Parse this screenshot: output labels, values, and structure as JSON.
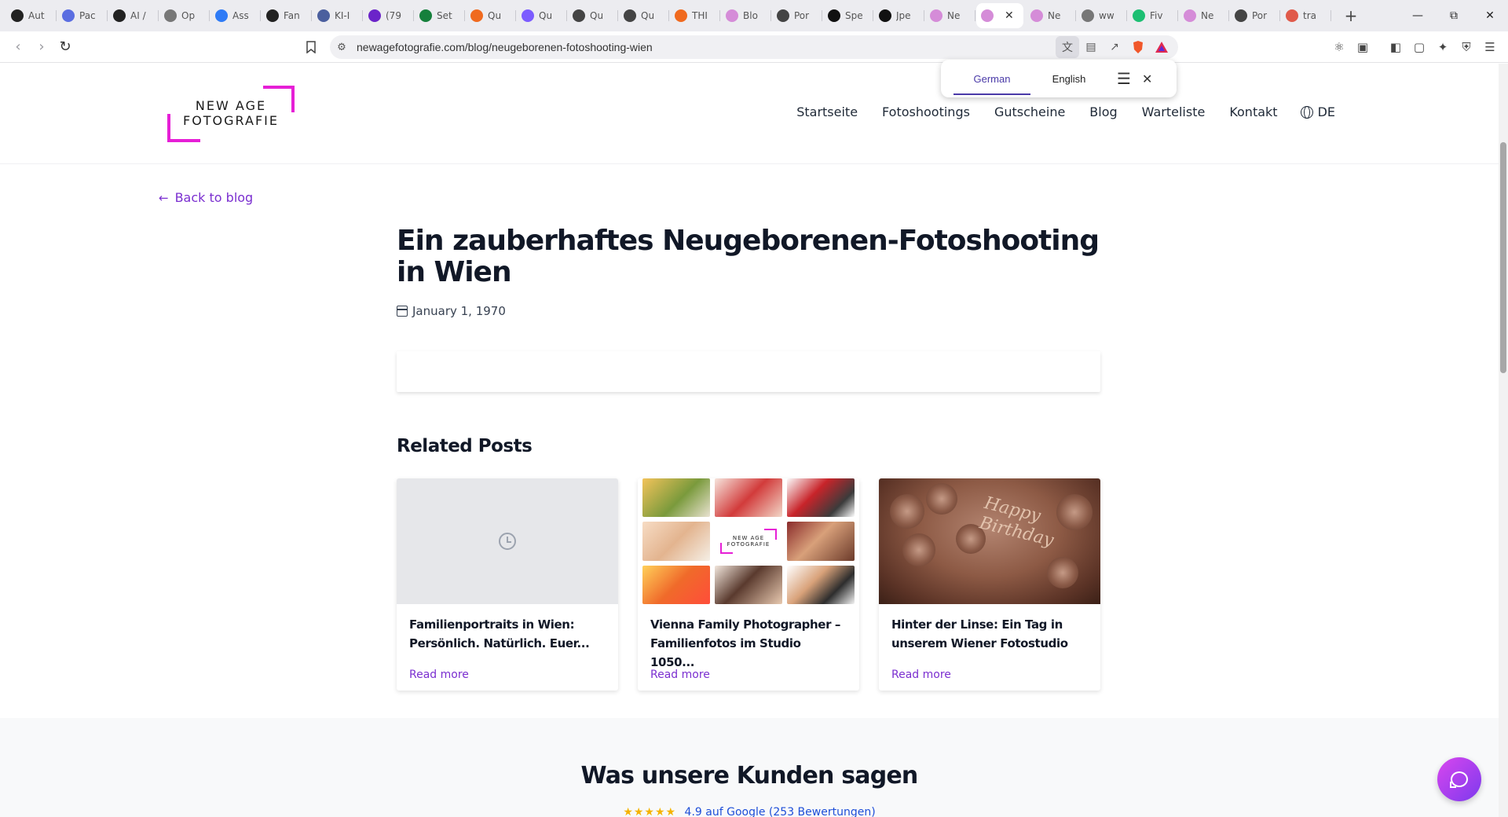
{
  "browser": {
    "tabs": [
      {
        "title": "Aut",
        "icon": "openai-icon",
        "color": "#222222"
      },
      {
        "title": "Pac",
        "icon": "globe-icon",
        "color": "#5b6ee1"
      },
      {
        "title": "AI /",
        "icon": "openai-icon",
        "color": "#222222"
      },
      {
        "title": "Op",
        "icon": "globe-icon",
        "color": "#777777"
      },
      {
        "title": "Ass",
        "icon": "globe-icon",
        "color": "#2f7bf6"
      },
      {
        "title": "Fan",
        "icon": "openai-icon",
        "color": "#222222"
      },
      {
        "title": "KI-I",
        "icon": "globe-icon",
        "color": "#4b5f9e"
      },
      {
        "title": "(79",
        "icon": "mail-icon",
        "color": "#6b24c9"
      },
      {
        "title": "Set",
        "icon": "chart-icon",
        "color": "#16803c"
      },
      {
        "title": "Qu",
        "icon": "grid-icon",
        "color": "#f06a1f"
      },
      {
        "title": "Qu",
        "icon": "s-icon",
        "color": "#7c5cff"
      },
      {
        "title": "Qu",
        "icon": "openai-icon",
        "color": "#444444"
      },
      {
        "title": "Qu",
        "icon": "openai-icon",
        "color": "#444444"
      },
      {
        "title": "THI",
        "icon": "grid-icon",
        "color": "#f06a1f"
      },
      {
        "title": "Blo",
        "icon": "page-icon",
        "color": "#d58cd8"
      },
      {
        "title": "Por",
        "icon": "openai-icon",
        "color": "#444444"
      },
      {
        "title": "Spe",
        "icon": "openai-icon",
        "color": "#111111"
      },
      {
        "title": "Jpe",
        "icon": "github-icon",
        "color": "#111111"
      },
      {
        "title": "Ne",
        "icon": "page-icon",
        "color": "#d58cd8"
      },
      {
        "title": "",
        "icon": "page-icon",
        "color": "#d58cd8",
        "active": true
      },
      {
        "title": "Ne",
        "icon": "page-icon",
        "color": "#d58cd8"
      },
      {
        "title": "ww",
        "icon": "globe-icon",
        "color": "#777777"
      },
      {
        "title": "Fiv",
        "icon": "fiverr-icon",
        "color": "#1dbf73"
      },
      {
        "title": "Ne",
        "icon": "page-icon",
        "color": "#d58cd8"
      },
      {
        "title": "Por",
        "icon": "openai-icon",
        "color": "#444444"
      },
      {
        "title": "tra",
        "icon": "globe-icon",
        "color": "#e05a4a"
      }
    ],
    "url": "newagefotografie.com/blog/neugeborenen-fotoshooting-wien",
    "translate": {
      "lang_from": "German",
      "lang_to": "English"
    }
  },
  "site": {
    "logo_line1": "NEW AGE",
    "logo_line2": "FOTOGRAFIE",
    "nav": [
      "Startseite",
      "Fotoshootings",
      "Gutscheine",
      "Blog",
      "Warteliste",
      "Kontakt"
    ],
    "lang": "DE",
    "accent": "#7b2fd0",
    "brand_magenta": "#e61fd6"
  },
  "post": {
    "back_label": "Back to blog",
    "title": "Ein zauberhaftes Neugeborenen-Fotoshooting in Wien",
    "date": "January 1, 1970"
  },
  "related": {
    "heading": "Related Posts",
    "read_more": "Read more",
    "items": [
      {
        "title": "Familienportraits in Wien: Persönlich. Natürlich. Euer...",
        "image": "placeholder"
      },
      {
        "title": "Vienna Family Photographer – Familienfotos im Studio 1050...",
        "image": "collage"
      },
      {
        "title": "Hinter der Linse: Ein Tag in unserem Wiener Fotostudio",
        "image": "cake"
      }
    ],
    "collage_logo_line1": "NEW AGE",
    "collage_logo_line2": "FOTOGRAFIE",
    "cake_text_line1": "Happy",
    "cake_text_line2": "Birthday"
  },
  "testimonials": {
    "heading": "Was unsere Kunden sagen",
    "stars": "★★★★★",
    "rating_text": "4.9 auf Google (253 Bewertungen)"
  }
}
